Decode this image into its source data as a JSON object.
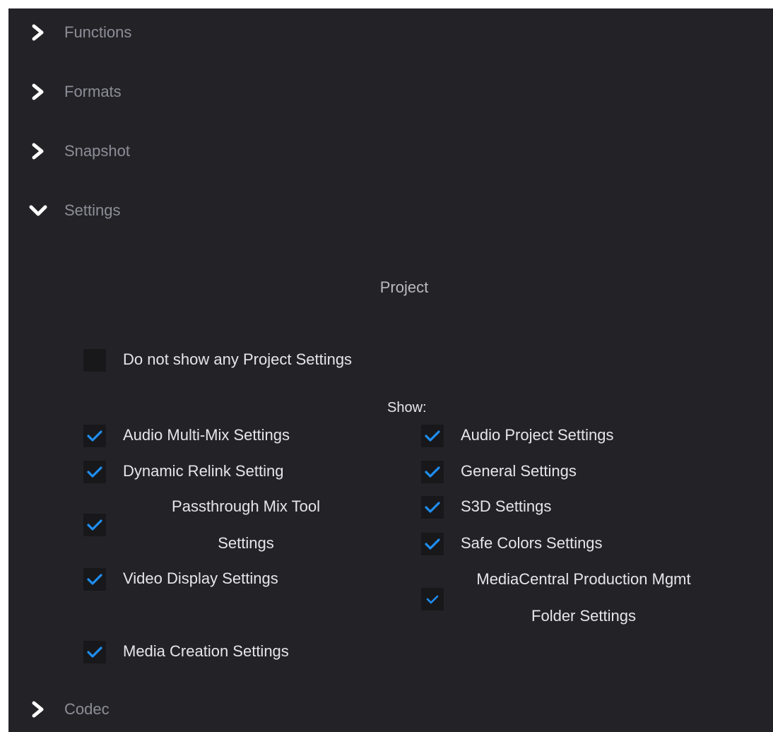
{
  "sections": {
    "functions": {
      "label": "Functions",
      "expanded": false
    },
    "formats": {
      "label": "Formats",
      "expanded": false
    },
    "snapshot": {
      "label": "Snapshot",
      "expanded": false
    },
    "settings": {
      "label": "Settings",
      "expanded": true
    },
    "codec": {
      "label": "Codec",
      "expanded": false
    }
  },
  "project": {
    "title": "Project",
    "do_not_show": {
      "label": "Do not show any Project Settings",
      "checked": false
    },
    "show_label": "Show:",
    "left_options": [
      {
        "label": "Audio Multi-Mix Settings",
        "checked": true
      },
      {
        "label": "Dynamic Relink Setting",
        "checked": true
      },
      {
        "label": "Passthrough Mix Tool Settings",
        "checked": true
      },
      {
        "label": "Video Display Settings",
        "checked": true
      },
      {
        "label": "Media Creation Settings",
        "checked": true
      }
    ],
    "right_options": [
      {
        "label": "Audio Project Settings",
        "checked": true
      },
      {
        "label": "General Settings",
        "checked": true
      },
      {
        "label": "S3D Settings",
        "checked": true
      },
      {
        "label": "Safe Colors Settings",
        "checked": true
      },
      {
        "label": "MediaCentral Production Mgmt Folder Settings",
        "checked": true
      }
    ]
  },
  "colors": {
    "panel_bg": "#232327",
    "header_text": "#8d8d98",
    "checkbox_bg": "#18181b",
    "check_accent": "#1f8ef1",
    "option_text": "#e6e6ea"
  },
  "icons": {
    "collapsed": "chevron-right-icon",
    "expanded": "chevron-down-icon",
    "checked": "checkmark-icon"
  }
}
